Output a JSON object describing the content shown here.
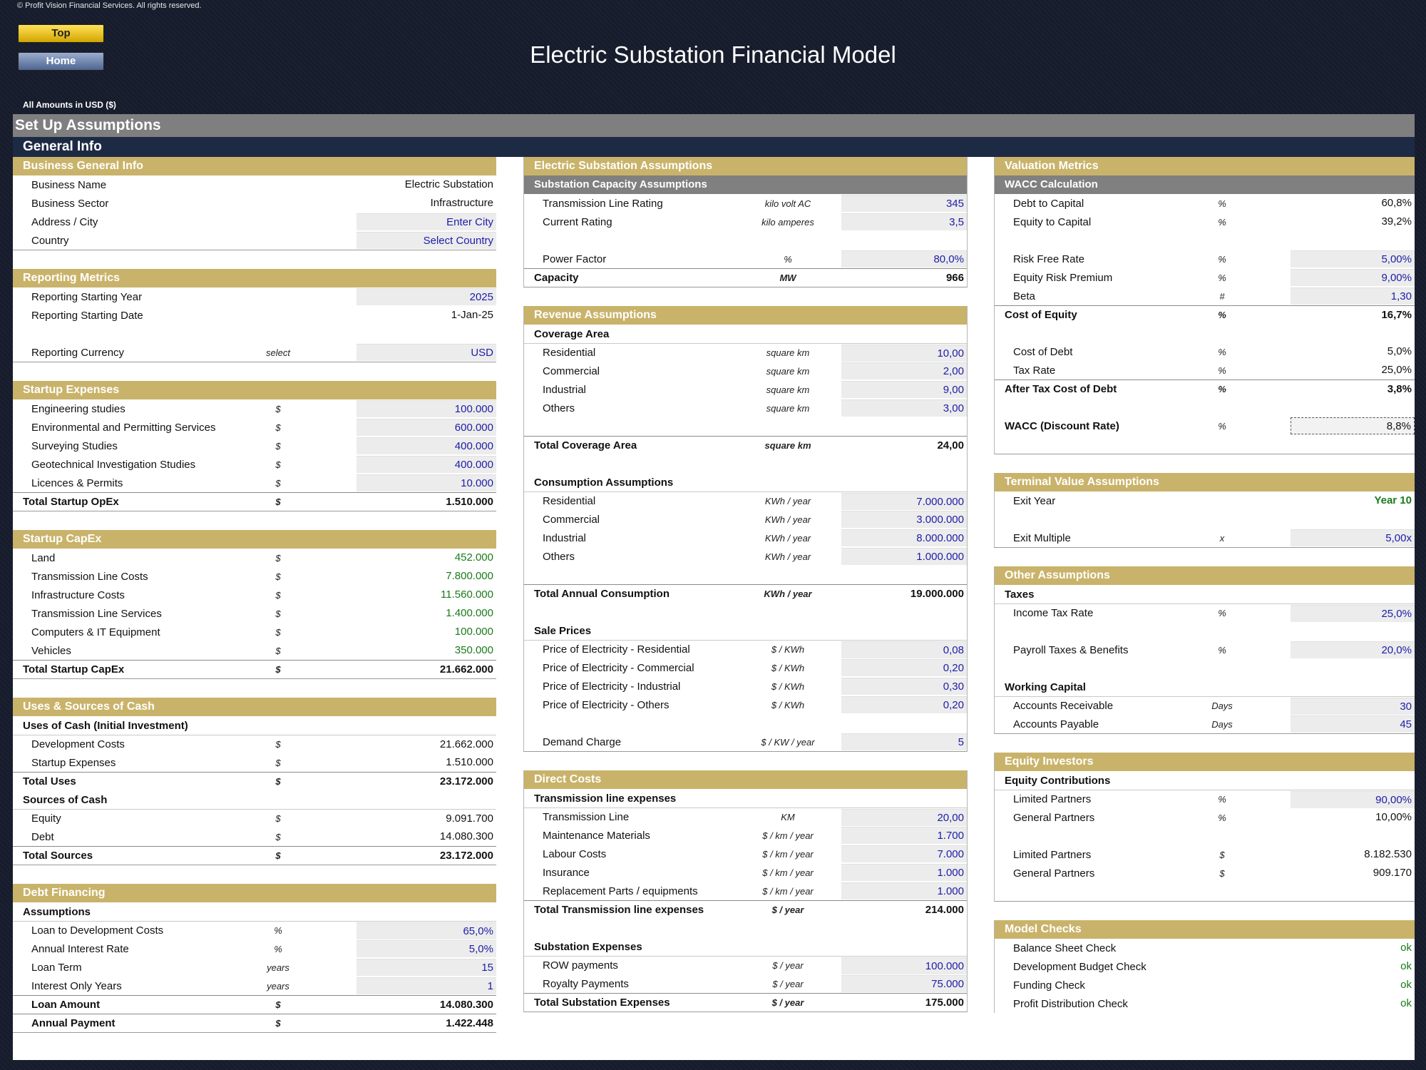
{
  "copyright": "© Profit Vision Financial Services. All rights reserved.",
  "nav": {
    "top": "Top",
    "home": "Home"
  },
  "title": "Electric Substation Financial Model",
  "currency_note": "All Amounts in  USD ($)",
  "setup_title": "Set Up Assumptions",
  "general_title": "General Info",
  "colors": {
    "section": "#c9b36a",
    "subsection": "#808080",
    "input_text": "#1c1ca8",
    "calc_text": "#1a7a1a",
    "header_bar": "#1d2a44"
  },
  "col1": {
    "business": {
      "title": "Business General Info",
      "rows": [
        {
          "label": "Business Name",
          "unit": "",
          "value": "Electric Substation"
        },
        {
          "label": "Business Sector",
          "unit": "",
          "value": "Infrastructure"
        },
        {
          "label": "Address / City",
          "unit": "",
          "value": "Enter City"
        },
        {
          "label": "Country",
          "unit": "",
          "value": "Select Country"
        }
      ]
    },
    "reporting": {
      "title": "Reporting Metrics",
      "rows": [
        {
          "label": "Reporting Starting Year",
          "unit": "",
          "value": "2025"
        },
        {
          "label": "Reporting Starting Date",
          "unit": "",
          "value": "1-Jan-25"
        },
        {
          "label": "Reporting Currency",
          "unit": "select",
          "value": "USD"
        }
      ]
    },
    "startup_exp": {
      "title": "Startup Expenses",
      "rows": [
        {
          "label": "Engineering studies",
          "unit": "$",
          "value": "100.000"
        },
        {
          "label": "Environmental and Permitting Services",
          "unit": "$",
          "value": "600.000"
        },
        {
          "label": "Surveying Studies",
          "unit": "$",
          "value": "400.000"
        },
        {
          "label": "Geotechnical Investigation Studies",
          "unit": "$",
          "value": "400.000"
        },
        {
          "label": "Licences & Permits",
          "unit": "$",
          "value": "10.000"
        },
        {
          "label": "Total Startup OpEx",
          "unit": "$",
          "value": "1.510.000"
        }
      ]
    },
    "capex": {
      "title": "Startup CapEx",
      "rows": [
        {
          "label": "Land",
          "unit": "$",
          "value": "452.000"
        },
        {
          "label": "Transmission Line Costs",
          "unit": "$",
          "value": "7.800.000"
        },
        {
          "label": "Infrastructure Costs",
          "unit": "$",
          "value": "11.560.000"
        },
        {
          "label": "Transmission Line Services",
          "unit": "$",
          "value": "1.400.000"
        },
        {
          "label": "Computers & IT Equipment",
          "unit": "$",
          "value": "100.000"
        },
        {
          "label": "Vehicles",
          "unit": "$",
          "value": "350.000"
        },
        {
          "label": "Total Startup CapEx",
          "unit": "$",
          "value": "21.662.000"
        }
      ]
    },
    "uses": {
      "title": "Uses & Sources of Cash",
      "uses_header": "Uses of Cash (Initial Investment)",
      "sources_header": "Sources of Cash",
      "rows": [
        {
          "label": "Development Costs",
          "unit": "$",
          "value": "21.662.000"
        },
        {
          "label": "Startup Expenses",
          "unit": "$",
          "value": "1.510.000"
        },
        {
          "label": "Total Uses",
          "unit": "$",
          "value": "23.172.000"
        },
        {
          "label": "Equity",
          "unit": "$",
          "value": "9.091.700"
        },
        {
          "label": "Debt",
          "unit": "$",
          "value": "14.080.300"
        },
        {
          "label": "Total Sources",
          "unit": "$",
          "value": "23.172.000"
        }
      ]
    },
    "debt": {
      "title": "Debt Financing",
      "assumptions_header": "Assumptions",
      "rows": [
        {
          "label": "Loan to Development Costs",
          "unit": "%",
          "value": "65,0%"
        },
        {
          "label": "Annual Interest Rate",
          "unit": "%",
          "value": "5,0%"
        },
        {
          "label": "Loan Term",
          "unit": "years",
          "value": "15"
        },
        {
          "label": "Interest Only Years",
          "unit": "years",
          "value": "1"
        },
        {
          "label": "Loan Amount",
          "unit": "$",
          "value": "14.080.300"
        },
        {
          "label": "Annual Payment",
          "unit": "$",
          "value": "1.422.448"
        }
      ]
    }
  },
  "col2": {
    "substation": {
      "title": "Electric Substation Assumptions",
      "sub_title": "Substation Capacity Assumptions",
      "rows": [
        {
          "label": "Transmission Line Rating",
          "unit": "kilo volt AC",
          "value": "345"
        },
        {
          "label": "Current Rating",
          "unit": "kilo amperes",
          "value": "3,5"
        },
        {
          "label": "Power Factor",
          "unit": "%",
          "value": "80,0%"
        },
        {
          "label": "Capacity",
          "unit": "MW",
          "value": "966"
        }
      ]
    },
    "revenue": {
      "title": "Revenue Assumptions",
      "coverage_header": "Coverage Area",
      "coverage": [
        {
          "label": "Residential",
          "unit": "square km",
          "value": "10,00"
        },
        {
          "label": "Commercial",
          "unit": "square km",
          "value": "2,00"
        },
        {
          "label": "Industrial",
          "unit": "square km",
          "value": "9,00"
        },
        {
          "label": "Others",
          "unit": "square km",
          "value": "3,00"
        }
      ],
      "coverage_total": {
        "label": "Total Coverage Area",
        "unit": "square km",
        "value": "24,00"
      },
      "consumption_header": "Consumption Assumptions",
      "consumption": [
        {
          "label": "Residential",
          "unit": "KWh / year",
          "value": "7.000.000"
        },
        {
          "label": "Commercial",
          "unit": "KWh / year",
          "value": "3.000.000"
        },
        {
          "label": "Industrial",
          "unit": "KWh / year",
          "value": "8.000.000"
        },
        {
          "label": "Others",
          "unit": "KWh / year",
          "value": "1.000.000"
        }
      ],
      "consumption_total": {
        "label": "Total Annual Consumption",
        "unit": "KWh / year",
        "value": "19.000.000"
      },
      "prices_header": "Sale Prices",
      "prices": [
        {
          "label": "Price of Electricity - Residential",
          "unit": "$ / KWh",
          "value": "0,08"
        },
        {
          "label": "Price of Electricity - Commercial",
          "unit": "$ / KWh",
          "value": "0,20"
        },
        {
          "label": "Price of Electricity - Industrial",
          "unit": "$ / KWh",
          "value": "0,30"
        },
        {
          "label": "Price of Electricity - Others",
          "unit": "$ / KWh",
          "value": "0,20"
        }
      ],
      "demand": {
        "label": "Demand Charge",
        "unit": "$ / KW / year",
        "value": "5"
      }
    },
    "direct": {
      "title": "Direct Costs",
      "tl_header": "Transmission line expenses",
      "tl_rows": [
        {
          "label": "Transmission Line",
          "unit": "KM",
          "value": "20,00"
        },
        {
          "label": "Maintenance Materials",
          "unit": "$ / km / year",
          "value": "1.700"
        },
        {
          "label": "Labour Costs",
          "unit": "$ / km / year",
          "value": "7.000"
        },
        {
          "label": "Insurance",
          "unit": "$ / km / year",
          "value": "1.000"
        },
        {
          "label": "Replacement Parts / equipments",
          "unit": "$ / km / year",
          "value": "1.000"
        }
      ],
      "tl_total": {
        "label": "Total Transmission line expenses",
        "unit": "$ /  year",
        "value": "214.000"
      },
      "sub_header": "Substation Expenses",
      "sub_rows": [
        {
          "label": "ROW payments",
          "unit": "$ / year",
          "value": "100.000"
        },
        {
          "label": "Royalty Payments",
          "unit": "$ / year",
          "value": "75.000"
        }
      ],
      "sub_total": {
        "label": "Total Substation Expenses",
        "unit": "$ / year",
        "value": "175.000"
      }
    }
  },
  "col3": {
    "valuation": {
      "title": "Valuation Metrics",
      "sub_title": "WACC Calculation",
      "rows": [
        {
          "label": "Debt to Capital",
          "unit": "%",
          "value": "60,8%"
        },
        {
          "label": "Equity to Capital",
          "unit": "%",
          "value": "39,2%"
        },
        {
          "label": "Risk Free Rate",
          "unit": "%",
          "value": "5,00%"
        },
        {
          "label": "Equity Risk Premium",
          "unit": "%",
          "value": "9,00%"
        },
        {
          "label": "Beta",
          "unit": "#",
          "value": "1,30"
        },
        {
          "label": "Cost of Equity",
          "unit": "%",
          "value": "16,7%"
        },
        {
          "label": "Cost of Debt",
          "unit": "%",
          "value": "5,0%"
        },
        {
          "label": "Tax Rate",
          "unit": "%",
          "value": "25,0%"
        },
        {
          "label": "After Tax Cost of Debt",
          "unit": "%",
          "value": "3,8%"
        },
        {
          "label": "WACC (Discount Rate)",
          "unit": "%",
          "value": "8,8%"
        }
      ]
    },
    "terminal": {
      "title": "Terminal Value Assumptions",
      "rows": [
        {
          "label": "Exit Year",
          "unit": "",
          "value": "Year 10"
        },
        {
          "label": "Exit Multiple",
          "unit": "x",
          "value": "5,00x"
        }
      ]
    },
    "other": {
      "title": "Other Assumptions",
      "taxes_header": "Taxes",
      "taxes": [
        {
          "label": "Income Tax Rate",
          "unit": "%",
          "value": "25,0%"
        },
        {
          "label": "Payroll Taxes & Benefits",
          "unit": "%",
          "value": "20,0%"
        }
      ],
      "wc_header": "Working Capital",
      "wc": [
        {
          "label": "Accounts Receivable",
          "unit": "Days",
          "value": "30"
        },
        {
          "label": "Accounts Payable",
          "unit": "Days",
          "value": "45"
        }
      ]
    },
    "equity": {
      "title": "Equity Investors",
      "contrib_header": "Equity Contributions",
      "rows": [
        {
          "label": "Limited Partners",
          "unit": "%",
          "value": "90,00%"
        },
        {
          "label": "General Partners",
          "unit": "%",
          "value": "10,00%"
        },
        {
          "label": "Limited Partners",
          "unit": "$",
          "value": "8.182.530"
        },
        {
          "label": "General Partners",
          "unit": "$",
          "value": "909.170"
        }
      ]
    },
    "checks": {
      "title": "Model Checks",
      "rows": [
        {
          "label": "Balance Sheet Check",
          "value": "ok"
        },
        {
          "label": "Development Budget Check",
          "value": "ok"
        },
        {
          "label": "Funding Check",
          "value": "ok"
        },
        {
          "label": "Profit Distribution Check",
          "value": "ok"
        }
      ]
    }
  }
}
